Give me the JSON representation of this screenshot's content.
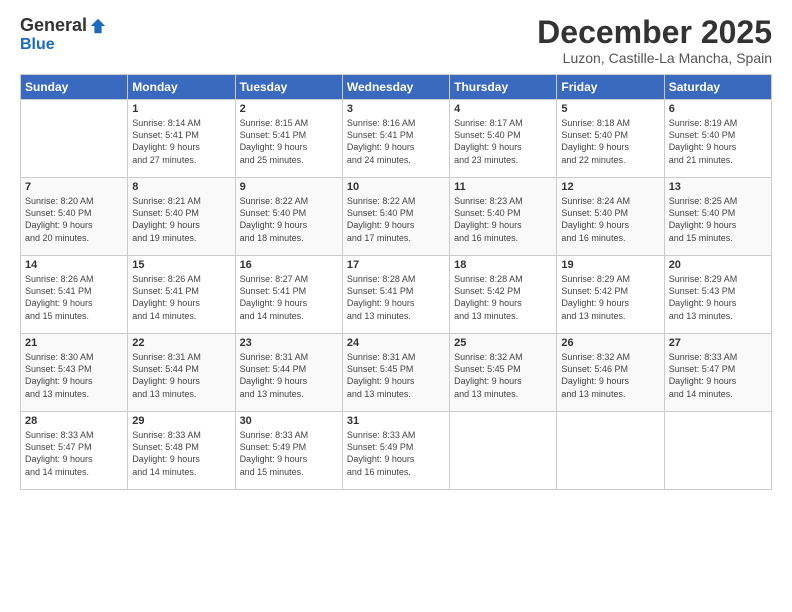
{
  "header": {
    "logo_general": "General",
    "logo_blue": "Blue",
    "month_title": "December 2025",
    "location": "Luzon, Castille-La Mancha, Spain"
  },
  "calendar": {
    "days_of_week": [
      "Sunday",
      "Monday",
      "Tuesday",
      "Wednesday",
      "Thursday",
      "Friday",
      "Saturday"
    ],
    "weeks": [
      [
        {
          "day": "",
          "info": ""
        },
        {
          "day": "1",
          "info": "Sunrise: 8:14 AM\nSunset: 5:41 PM\nDaylight: 9 hours\nand 27 minutes."
        },
        {
          "day": "2",
          "info": "Sunrise: 8:15 AM\nSunset: 5:41 PM\nDaylight: 9 hours\nand 25 minutes."
        },
        {
          "day": "3",
          "info": "Sunrise: 8:16 AM\nSunset: 5:41 PM\nDaylight: 9 hours\nand 24 minutes."
        },
        {
          "day": "4",
          "info": "Sunrise: 8:17 AM\nSunset: 5:40 PM\nDaylight: 9 hours\nand 23 minutes."
        },
        {
          "day": "5",
          "info": "Sunrise: 8:18 AM\nSunset: 5:40 PM\nDaylight: 9 hours\nand 22 minutes."
        },
        {
          "day": "6",
          "info": "Sunrise: 8:19 AM\nSunset: 5:40 PM\nDaylight: 9 hours\nand 21 minutes."
        }
      ],
      [
        {
          "day": "7",
          "info": "Sunrise: 8:20 AM\nSunset: 5:40 PM\nDaylight: 9 hours\nand 20 minutes."
        },
        {
          "day": "8",
          "info": "Sunrise: 8:21 AM\nSunset: 5:40 PM\nDaylight: 9 hours\nand 19 minutes."
        },
        {
          "day": "9",
          "info": "Sunrise: 8:22 AM\nSunset: 5:40 PM\nDaylight: 9 hours\nand 18 minutes."
        },
        {
          "day": "10",
          "info": "Sunrise: 8:22 AM\nSunset: 5:40 PM\nDaylight: 9 hours\nand 17 minutes."
        },
        {
          "day": "11",
          "info": "Sunrise: 8:23 AM\nSunset: 5:40 PM\nDaylight: 9 hours\nand 16 minutes."
        },
        {
          "day": "12",
          "info": "Sunrise: 8:24 AM\nSunset: 5:40 PM\nDaylight: 9 hours\nand 16 minutes."
        },
        {
          "day": "13",
          "info": "Sunrise: 8:25 AM\nSunset: 5:40 PM\nDaylight: 9 hours\nand 15 minutes."
        }
      ],
      [
        {
          "day": "14",
          "info": "Sunrise: 8:26 AM\nSunset: 5:41 PM\nDaylight: 9 hours\nand 15 minutes."
        },
        {
          "day": "15",
          "info": "Sunrise: 8:26 AM\nSunset: 5:41 PM\nDaylight: 9 hours\nand 14 minutes."
        },
        {
          "day": "16",
          "info": "Sunrise: 8:27 AM\nSunset: 5:41 PM\nDaylight: 9 hours\nand 14 minutes."
        },
        {
          "day": "17",
          "info": "Sunrise: 8:28 AM\nSunset: 5:41 PM\nDaylight: 9 hours\nand 13 minutes."
        },
        {
          "day": "18",
          "info": "Sunrise: 8:28 AM\nSunset: 5:42 PM\nDaylight: 9 hours\nand 13 minutes."
        },
        {
          "day": "19",
          "info": "Sunrise: 8:29 AM\nSunset: 5:42 PM\nDaylight: 9 hours\nand 13 minutes."
        },
        {
          "day": "20",
          "info": "Sunrise: 8:29 AM\nSunset: 5:43 PM\nDaylight: 9 hours\nand 13 minutes."
        }
      ],
      [
        {
          "day": "21",
          "info": "Sunrise: 8:30 AM\nSunset: 5:43 PM\nDaylight: 9 hours\nand 13 minutes."
        },
        {
          "day": "22",
          "info": "Sunrise: 8:31 AM\nSunset: 5:44 PM\nDaylight: 9 hours\nand 13 minutes."
        },
        {
          "day": "23",
          "info": "Sunrise: 8:31 AM\nSunset: 5:44 PM\nDaylight: 9 hours\nand 13 minutes."
        },
        {
          "day": "24",
          "info": "Sunrise: 8:31 AM\nSunset: 5:45 PM\nDaylight: 9 hours\nand 13 minutes."
        },
        {
          "day": "25",
          "info": "Sunrise: 8:32 AM\nSunset: 5:45 PM\nDaylight: 9 hours\nand 13 minutes."
        },
        {
          "day": "26",
          "info": "Sunrise: 8:32 AM\nSunset: 5:46 PM\nDaylight: 9 hours\nand 13 minutes."
        },
        {
          "day": "27",
          "info": "Sunrise: 8:33 AM\nSunset: 5:47 PM\nDaylight: 9 hours\nand 14 minutes."
        }
      ],
      [
        {
          "day": "28",
          "info": "Sunrise: 8:33 AM\nSunset: 5:47 PM\nDaylight: 9 hours\nand 14 minutes."
        },
        {
          "day": "29",
          "info": "Sunrise: 8:33 AM\nSunset: 5:48 PM\nDaylight: 9 hours\nand 14 minutes."
        },
        {
          "day": "30",
          "info": "Sunrise: 8:33 AM\nSunset: 5:49 PM\nDaylight: 9 hours\nand 15 minutes."
        },
        {
          "day": "31",
          "info": "Sunrise: 8:33 AM\nSunset: 5:49 PM\nDaylight: 9 hours\nand 16 minutes."
        },
        {
          "day": "",
          "info": ""
        },
        {
          "day": "",
          "info": ""
        },
        {
          "day": "",
          "info": ""
        }
      ]
    ]
  }
}
